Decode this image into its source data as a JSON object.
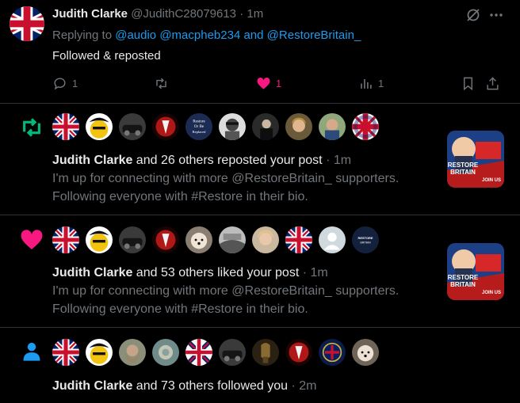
{
  "reply_post": {
    "author_name": "Judith Clarke",
    "author_handle": "@JudithC28079613",
    "separator": "·",
    "time": "1m",
    "replying_prefix": "Replying to",
    "mention_1": "@audio",
    "mention_2": "@macpheb234",
    "mention_and": "and",
    "mention_3": "@RestoreBritain_",
    "text": "Followed & reposted",
    "reply_count": "1",
    "repost_count": "",
    "like_count": "1",
    "view_count": "1"
  },
  "notifications": [
    {
      "type": "repost",
      "icon": "repost-icon",
      "actor": "Judith Clarke",
      "summary": " and 26 others reposted your post",
      "separator": "·",
      "time": "1m",
      "body_line1": "I'm up for connecting with more @RestoreBritain_  supporters.",
      "body_line2": "Following everyone with  #Restore in their bio.",
      "avatar_badge_text": [
        "Restore",
        "Or Be",
        "Replaced"
      ],
      "thumb_text": [
        "RESTORE",
        "BRITAIN",
        "JOIN US"
      ]
    },
    {
      "type": "like",
      "icon": "heart-icon",
      "actor": "Judith Clarke",
      "summary": " and 53 others liked your post",
      "separator": "·",
      "time": "1m",
      "body_line1": "I'm up for connecting with more @RestoreBritain_  supporters.",
      "body_line2": "Following everyone with  #Restore in their bio.",
      "avatar_badge_text": [
        "RESTORE",
        "BRITAIN"
      ],
      "thumb_text": [
        "RESTORE",
        "BRITAIN",
        "JOIN US"
      ]
    },
    {
      "type": "follow",
      "icon": "person-icon",
      "actor": "Judith Clarke",
      "summary": " and 73 others followed you",
      "separator": "·",
      "time": "2m"
    }
  ],
  "colors": {
    "background": "#000000",
    "text": "#e7e9ea",
    "muted": "#71767b",
    "link": "#1d9bf0",
    "like": "#f91880",
    "repost": "#00ba7c",
    "divider": "#2f3336"
  }
}
